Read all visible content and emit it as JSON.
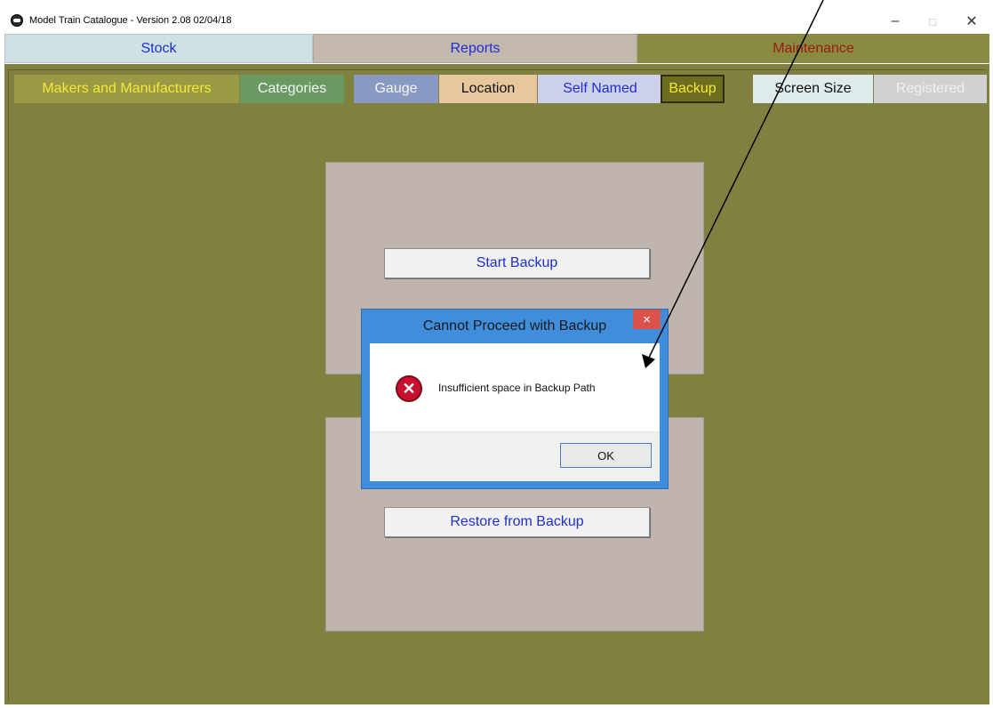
{
  "window": {
    "title": "Model Train Catalogue - Version 2.08 02/04/18",
    "minimize_glyph": "–",
    "maximize_glyph": "□",
    "close_glyph": "✕"
  },
  "main_tabs": [
    "Stock",
    "Reports",
    "Maintenance"
  ],
  "sub_tabs": [
    "Makers and Manufacturers",
    "Categories",
    "Gauge",
    "Location",
    "Self Named",
    "Backup",
    "Screen Size",
    "Registered"
  ],
  "panel": {
    "start_backup_label": "Start Backup",
    "restore_backup_label": "Restore from Backup"
  },
  "dialog": {
    "title": "Cannot Proceed with Backup",
    "close_glyph": "×",
    "message": "Insufficient space in Backup Path",
    "ok_label": "OK"
  }
}
